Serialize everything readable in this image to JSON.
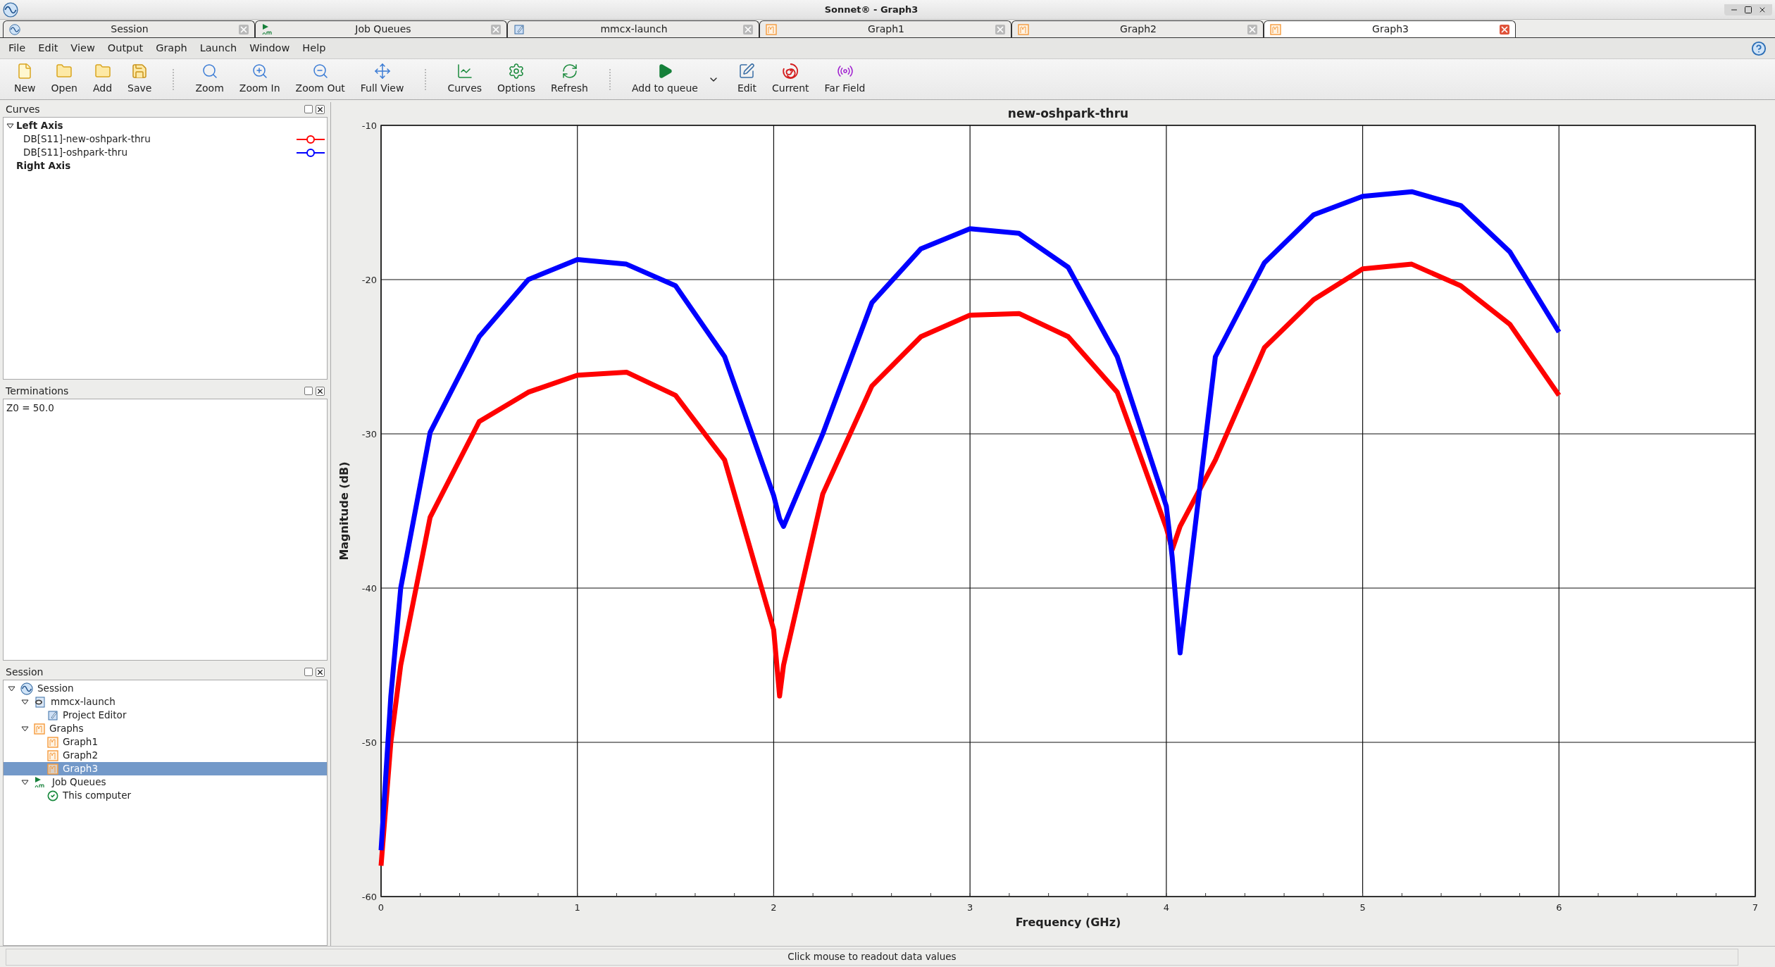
{
  "window": {
    "title": "Sonnet® - Graph3"
  },
  "document_tabs": [
    {
      "label": "Session",
      "kind": "session",
      "selected": false
    },
    {
      "label": "Job Queues",
      "kind": "queue",
      "selected": false
    },
    {
      "label": "mmcx-launch",
      "kind": "editor",
      "selected": false
    },
    {
      "label": "Graph1",
      "kind": "graph",
      "selected": false
    },
    {
      "label": "Graph2",
      "kind": "graph",
      "selected": false
    },
    {
      "label": "Graph3",
      "kind": "graph",
      "selected": true
    }
  ],
  "menu": [
    "File",
    "Edit",
    "View",
    "Output",
    "Graph",
    "Launch",
    "Window",
    "Help"
  ],
  "toolbar": [
    {
      "label": "New",
      "kind": "new"
    },
    {
      "label": "Open",
      "kind": "open"
    },
    {
      "label": "Add",
      "kind": "add"
    },
    {
      "label": "Save",
      "kind": "save"
    },
    {
      "label": "Zoom",
      "kind": "zoom"
    },
    {
      "label": "Zoom In",
      "kind": "zoom-in"
    },
    {
      "label": "Zoom Out",
      "kind": "zoom-out"
    },
    {
      "label": "Full View",
      "kind": "full-view"
    },
    {
      "label": "Curves",
      "kind": "curves"
    },
    {
      "label": "Options",
      "kind": "options"
    },
    {
      "label": "Refresh",
      "kind": "refresh"
    },
    {
      "label": "Add to queue",
      "kind": "queue"
    },
    {
      "label": "Edit",
      "kind": "edit"
    },
    {
      "label": "Current",
      "kind": "current"
    },
    {
      "label": "Far Field",
      "kind": "far-field"
    }
  ],
  "curves_panel": {
    "title": "Curves",
    "groups": [
      {
        "label": "Left Axis",
        "expanded": true,
        "curves": [
          {
            "label": "DB[S11]-new-oshpark-thru",
            "color": "#ff0000"
          },
          {
            "label": "DB[S11]-oshpark-thru",
            "color": "#0000ff"
          }
        ]
      },
      {
        "label": "Right Axis"
      }
    ]
  },
  "terminations_panel": {
    "title": "Terminations",
    "lines": [
      "Z0 = 50.0"
    ]
  },
  "session_panel": {
    "title": "Session",
    "tree": [
      {
        "label": "Session",
        "kind": "session",
        "expanded": true,
        "selected": false,
        "children": [
          {
            "label": "mmcx-launch",
            "kind": "project",
            "expanded": true,
            "selected": false,
            "children": [
              {
                "label": "Project Editor",
                "kind": "editor",
                "selected": false
              }
            ]
          },
          {
            "label": "Graphs",
            "kind": "graph",
            "expanded": true,
            "selected": false,
            "children": [
              {
                "label": "Graph1",
                "kind": "graph",
                "selected": false
              },
              {
                "label": "Graph2",
                "kind": "graph",
                "selected": false
              },
              {
                "label": "Graph3",
                "kind": "graph",
                "selected": true
              }
            ]
          },
          {
            "label": "Job Queues",
            "kind": "queue",
            "expanded": true,
            "selected": false,
            "children": [
              {
                "label": "This computer",
                "kind": "computer",
                "selected": false
              }
            ]
          }
        ]
      }
    ]
  },
  "chart": {
    "chart_data": {
      "type": "line",
      "title": "new-oshpark-thru",
      "xlabel": "Frequency (GHz)",
      "ylabel": "Magnitude (dB)",
      "grid": true,
      "x": [
        0,
        0.05,
        0.1,
        0.25,
        0.5,
        0.75,
        1,
        1.25,
        1.5,
        1.75,
        2,
        2.03,
        2.05,
        2.25,
        2.5,
        2.75,
        3,
        3.25,
        3.5,
        3.75,
        4,
        4.03,
        4.07,
        4.25,
        4.5,
        4.75,
        5,
        5.25,
        5.5,
        5.75,
        6
      ],
      "series": [
        {
          "color": "#ff0000",
          "values": [
            -58,
            -50,
            -45,
            -35.4,
            -29.2,
            -27.3,
            -26.2,
            -26,
            -27.5,
            -31.7,
            -42.7,
            -47,
            -45,
            -33.9,
            -26.9,
            -23.7,
            -22.3,
            -22.2,
            -23.7,
            -27.3,
            -36.1,
            -37.5,
            -36,
            -31.7,
            -24.4,
            -21.3,
            -19.3,
            -19,
            -20.4,
            -22.9,
            -27.5
          ]
        },
        {
          "color": "#0000ff",
          "values": [
            -57,
            -47,
            -40,
            -29.9,
            -23.7,
            -20,
            -18.7,
            -19,
            -20.4,
            -25,
            -34,
            -35.5,
            -36,
            -30,
            -21.5,
            -18,
            -16.7,
            -17,
            -19.2,
            -25,
            -34.7,
            -38,
            -44.2,
            -25,
            -18.9,
            -15.8,
            -14.6,
            -14.3,
            -15.2,
            -18.2,
            -23.4
          ]
        }
      ],
      "xlim": [
        0,
        7
      ],
      "ylim": [
        -60,
        -10
      ],
      "xticks": [
        0,
        1,
        2,
        3,
        4,
        5,
        6,
        7
      ],
      "yticks": [
        -60,
        -50,
        -40,
        -30,
        -20,
        -10
      ]
    }
  },
  "status_bar": "Click mouse to readout data values"
}
